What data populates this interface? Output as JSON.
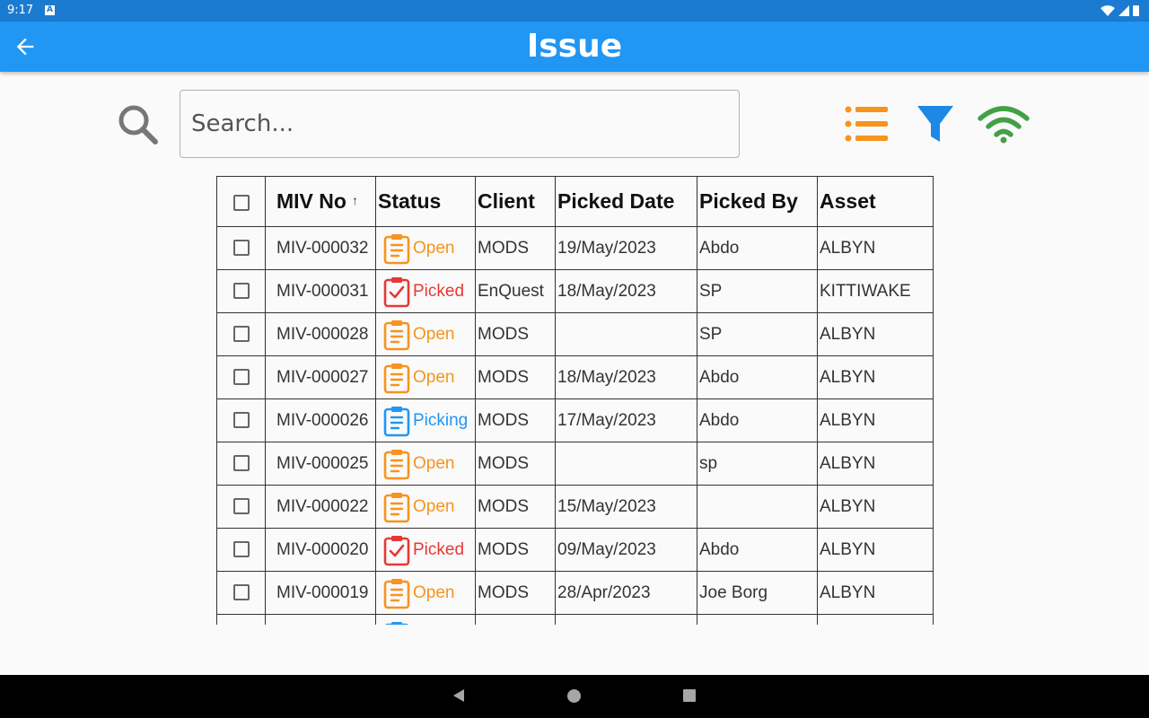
{
  "status_bar": {
    "time": "9:17",
    "notification_icon": "a-icon"
  },
  "app_bar": {
    "title": "Issue",
    "back_icon": "arrow-back-icon"
  },
  "search": {
    "placeholder": "Search...",
    "value": ""
  },
  "toolbar": {
    "list_icon": "list-icon",
    "filter_icon": "filter-icon",
    "wifi_icon": "wifi-icon"
  },
  "colors": {
    "app_bar": "#2196f3",
    "status_bar": "#1a7bd0",
    "open": "#f7931e",
    "picked": "#e53935",
    "picking": "#2196f3",
    "list_icon": "#f7931e",
    "filter_icon": "#1e88e5",
    "wifi_icon": "#43a047"
  },
  "table": {
    "headers": {
      "miv_no": "MIV No",
      "status": "Status",
      "client": "Client",
      "picked_date": "Picked Date",
      "picked_by": "Picked By",
      "asset": "Asset"
    },
    "sort": {
      "column": "miv_no",
      "direction": "ascending"
    },
    "rows": [
      {
        "miv_no": "MIV-000032",
        "status": "Open",
        "status_key": "open",
        "client": "MODS",
        "picked_date": "19/May/2023",
        "picked_by": "Abdo",
        "asset": "ALBYN"
      },
      {
        "miv_no": "MIV-000031",
        "status": "Picked",
        "status_key": "picked",
        "client": "EnQuest",
        "picked_date": "18/May/2023",
        "picked_by": "SP",
        "asset": "KITTIWAKE"
      },
      {
        "miv_no": "MIV-000028",
        "status": "Open",
        "status_key": "open",
        "client": "MODS",
        "picked_date": "",
        "picked_by": "SP",
        "asset": "ALBYN"
      },
      {
        "miv_no": "MIV-000027",
        "status": "Open",
        "status_key": "open",
        "client": "MODS",
        "picked_date": "18/May/2023",
        "picked_by": "Abdo",
        "asset": "ALBYN"
      },
      {
        "miv_no": "MIV-000026",
        "status": "Picking",
        "status_key": "picking",
        "client": "MODS",
        "picked_date": "17/May/2023",
        "picked_by": "Abdo",
        "asset": "ALBYN"
      },
      {
        "miv_no": "MIV-000025",
        "status": "Open",
        "status_key": "open",
        "client": "MODS",
        "picked_date": "",
        "picked_by": "sp",
        "asset": "ALBYN"
      },
      {
        "miv_no": "MIV-000022",
        "status": "Open",
        "status_key": "open",
        "client": "MODS",
        "picked_date": "15/May/2023",
        "picked_by": "",
        "asset": "ALBYN"
      },
      {
        "miv_no": "MIV-000020",
        "status": "Picked",
        "status_key": "picked",
        "client": "MODS",
        "picked_date": "09/May/2023",
        "picked_by": "Abdo",
        "asset": "ALBYN"
      },
      {
        "miv_no": "MIV-000019",
        "status": "Open",
        "status_key": "open",
        "client": "MODS",
        "picked_date": "28/Apr/2023",
        "picked_by": "Joe Borg",
        "asset": "ALBYN"
      },
      {
        "miv_no": "",
        "status": "",
        "status_key": "picking",
        "client": "",
        "picked_date": "",
        "picked_by": "",
        "asset": ""
      }
    ]
  },
  "nav_bar": {
    "back_icon": "nav-back-icon",
    "home_icon": "nav-home-icon",
    "recents_icon": "nav-recents-icon"
  }
}
